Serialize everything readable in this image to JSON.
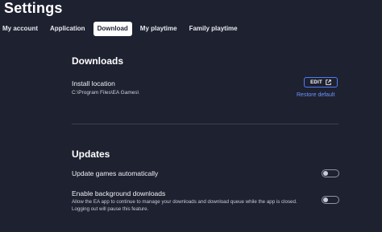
{
  "page": {
    "title": "Settings"
  },
  "tabs": [
    {
      "label": "My account"
    },
    {
      "label": "Application"
    },
    {
      "label": "Download"
    },
    {
      "label": "My playtime"
    },
    {
      "label": "Family playtime"
    }
  ],
  "downloads": {
    "heading": "Downloads",
    "install_location_label": "Install location",
    "install_location_path": "C:\\Program Files\\EA Games\\",
    "edit_label": "EDIT",
    "restore_label": "Restore default"
  },
  "updates": {
    "heading": "Updates",
    "auto_update_label": "Update games automatically",
    "auto_update_enabled": false,
    "background_label": "Enable background downloads",
    "background_description": "Allow the EA app to continue to manage your downloads and download queue while the app is closed. Logging out will pause this feature.",
    "background_enabled": false
  },
  "colors": {
    "background": "#1e2130",
    "accent": "#4d7df5",
    "link": "#6c93ff"
  }
}
